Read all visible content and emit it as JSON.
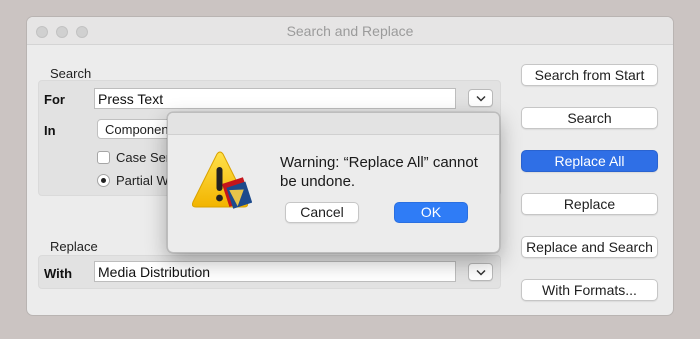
{
  "window": {
    "title": "Search and Replace"
  },
  "search": {
    "section_label": "Search",
    "for_label": "For",
    "for_value": "Press Text",
    "in_label": "In",
    "in_value": "Componen",
    "case_label": "Case Sen",
    "partial_label": "Partial W"
  },
  "replace": {
    "section_label": "Replace",
    "with_label": "With",
    "with_value": "Media Distribution"
  },
  "buttons": {
    "search_from_start": "Search from Start",
    "search": "Search",
    "replace_all": "Replace All",
    "replace": "Replace",
    "replace_and_search": "Replace and Search",
    "with_formats": "With Formats..."
  },
  "alert": {
    "message": "Warning: “Replace All” cannot be undone.",
    "cancel_label": "Cancel",
    "ok_label": "OK"
  },
  "icons": {
    "warning": "warning-icon",
    "chevron": "chevron-down-icon"
  },
  "colors": {
    "accent": "#2f6fe6",
    "warning_yellow": "#f6c400"
  }
}
